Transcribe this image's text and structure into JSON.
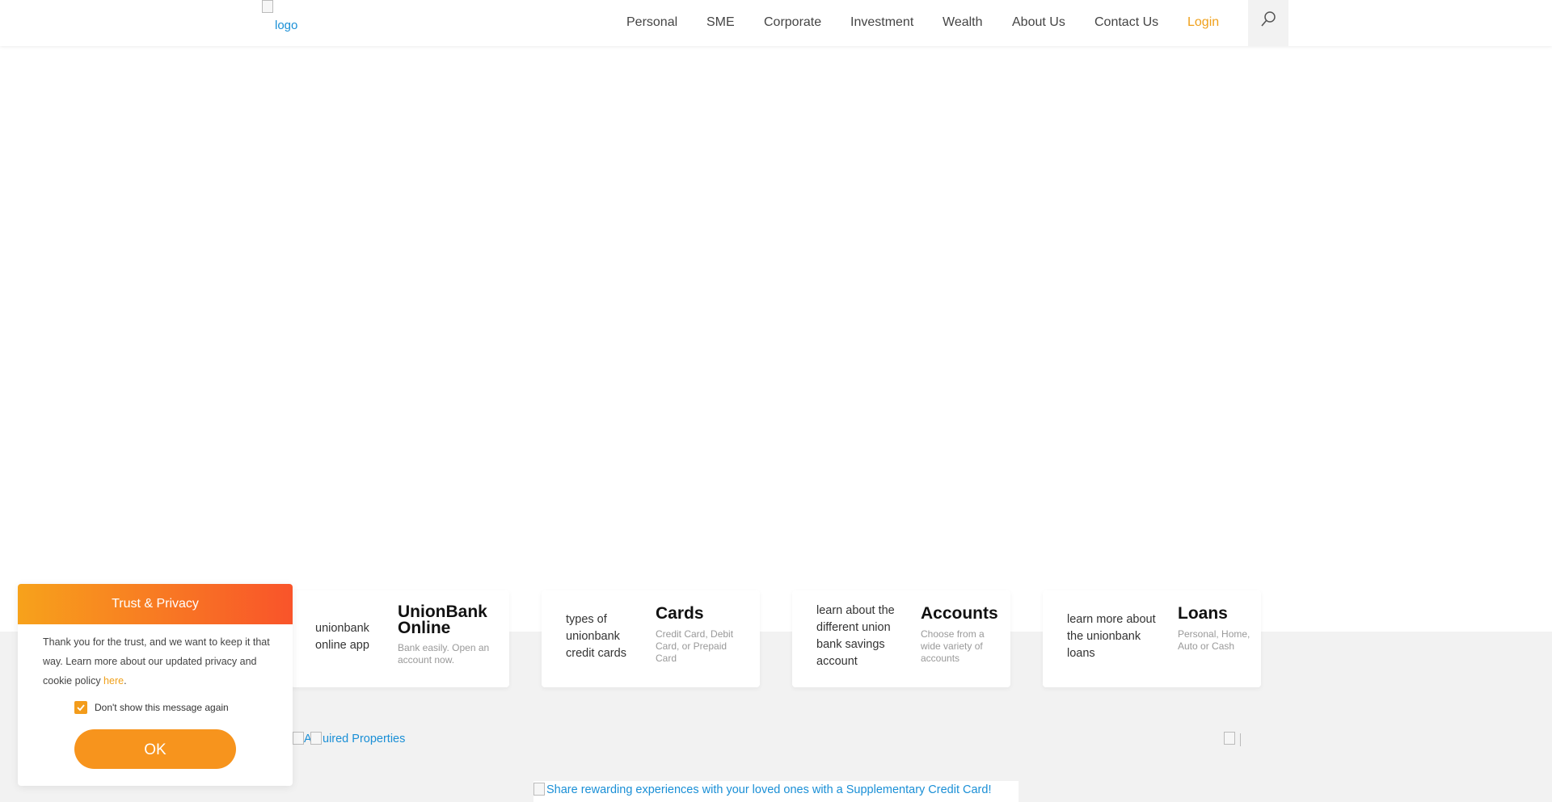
{
  "header": {
    "logo_alt": "logo",
    "nav": [
      "Personal",
      "SME",
      "Corporate",
      "Investment",
      "Wealth",
      "About Us",
      "Contact Us"
    ],
    "login": "Login",
    "search_icon": "search-icon"
  },
  "cards": [
    {
      "img_alt": "unionbank online app",
      "title": "UnionBank Online",
      "desc": "Bank easily. Open an account now."
    },
    {
      "img_alt": "types of unionbank credit cards",
      "title": "Cards",
      "desc": "Credit Card, Debit Card, or Prepaid Card"
    },
    {
      "img_alt": "learn about the different union bank savings account",
      "title": "Accounts",
      "desc": "Choose from a wide variety of accounts"
    },
    {
      "img_alt": "learn more about the unionbank loans",
      "title": "Loans",
      "desc": "Personal, Home, Auto or Cash"
    }
  ],
  "links": {
    "acquired_a": "A",
    "acquired_properties": "uired Properties",
    "promo": "Share rewarding experiences with your loved ones with a Supplementary Credit Card!"
  },
  "cookie": {
    "title": "Trust & Privacy",
    "message": "Thank you for the trust, and we want to keep it that way. Learn more about our updated privacy and cookie policy ",
    "link": "here",
    "period": ".",
    "checkbox_label": "Don't show this message again",
    "checked": true,
    "ok": "OK"
  },
  "colors": {
    "accent": "#f7941d",
    "login": "#f0a01a",
    "link": "#1a8fd6",
    "band": "#f2f2f2"
  }
}
